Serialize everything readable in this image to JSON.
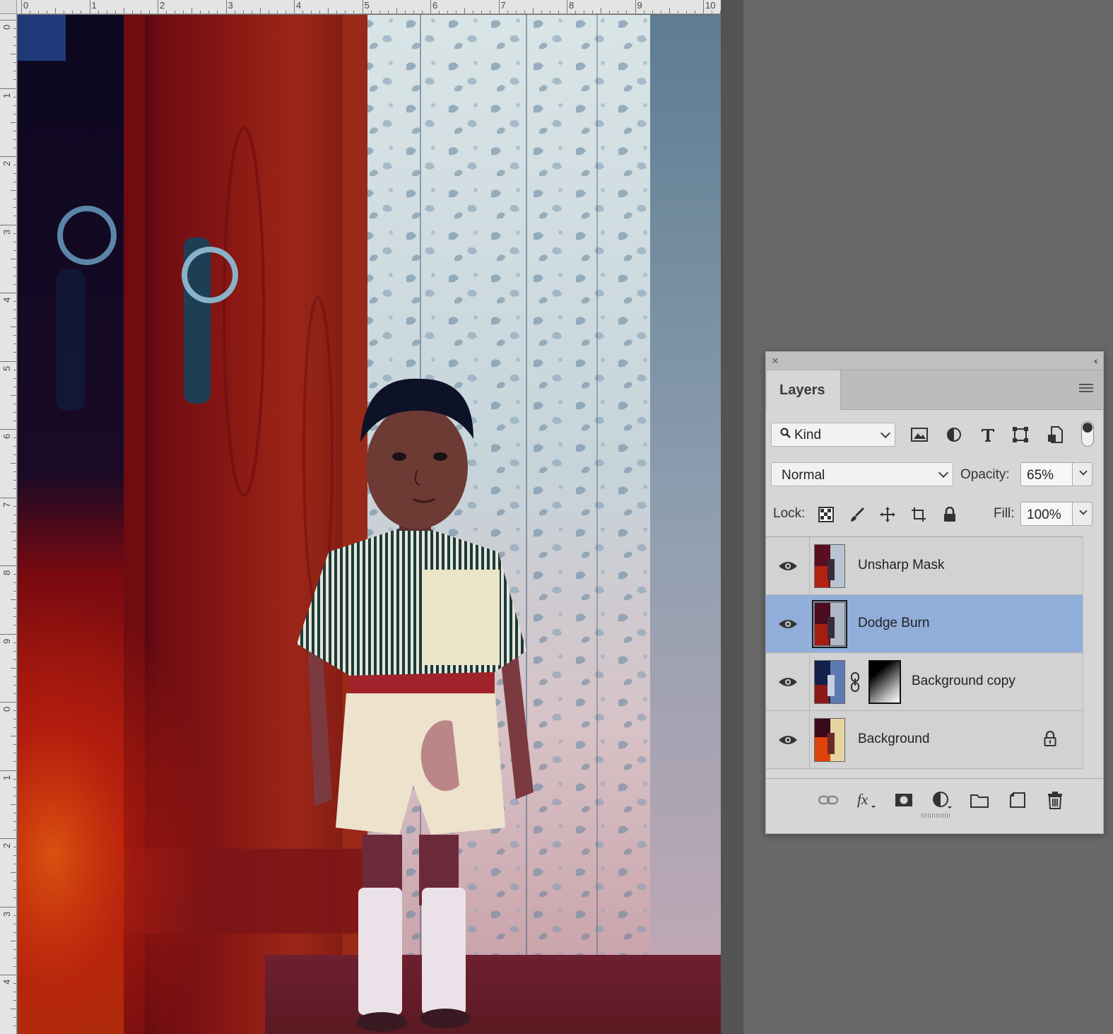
{
  "ruler": {
    "horizontal_marks": [
      "0",
      "1",
      "2",
      "3",
      "4",
      "5",
      "6",
      "7",
      "8",
      "9",
      "10"
    ],
    "vertical_marks": [
      "0",
      "1",
      "2",
      "3",
      "4",
      "5",
      "6",
      "7",
      "8",
      "9",
      "0",
      "1",
      "2",
      "3",
      "4"
    ]
  },
  "canvas": {
    "image_content": "photo-child-standing-by-wooden-door-and-floral-curtain"
  },
  "layers_panel": {
    "tab_label": "Layers",
    "filter": {
      "kind_label": "Kind",
      "filter_icons": [
        "image-filter-icon",
        "adjustment-filter-icon",
        "type-filter-icon",
        "shape-filter-icon",
        "smart-object-filter-icon"
      ]
    },
    "blend_mode": "Normal",
    "opacity_label": "Opacity:",
    "opacity_value": "65%",
    "lock_label": "Lock:",
    "fill_label": "Fill:",
    "fill_value": "100%",
    "layers": [
      {
        "name": "Unsharp Mask",
        "visible": true,
        "selected": false,
        "has_mask": false,
        "locked": false
      },
      {
        "name": "Dodge Burn",
        "visible": true,
        "selected": true,
        "has_mask": false,
        "locked": false
      },
      {
        "name": "Background copy",
        "visible": true,
        "selected": false,
        "has_mask": true,
        "locked": false
      },
      {
        "name": "Background",
        "visible": true,
        "selected": false,
        "has_mask": false,
        "locked": true
      }
    ],
    "bottom_tools": [
      "link-layers-icon",
      "fx-icon",
      "add-mask-icon",
      "adjustment-layer-icon",
      "new-group-icon",
      "new-layer-icon",
      "trash-icon"
    ]
  },
  "colors": {
    "workspace_bg": "#686868",
    "panel_bg": "#d6d6d6",
    "selected_layer": "#91aedb"
  }
}
